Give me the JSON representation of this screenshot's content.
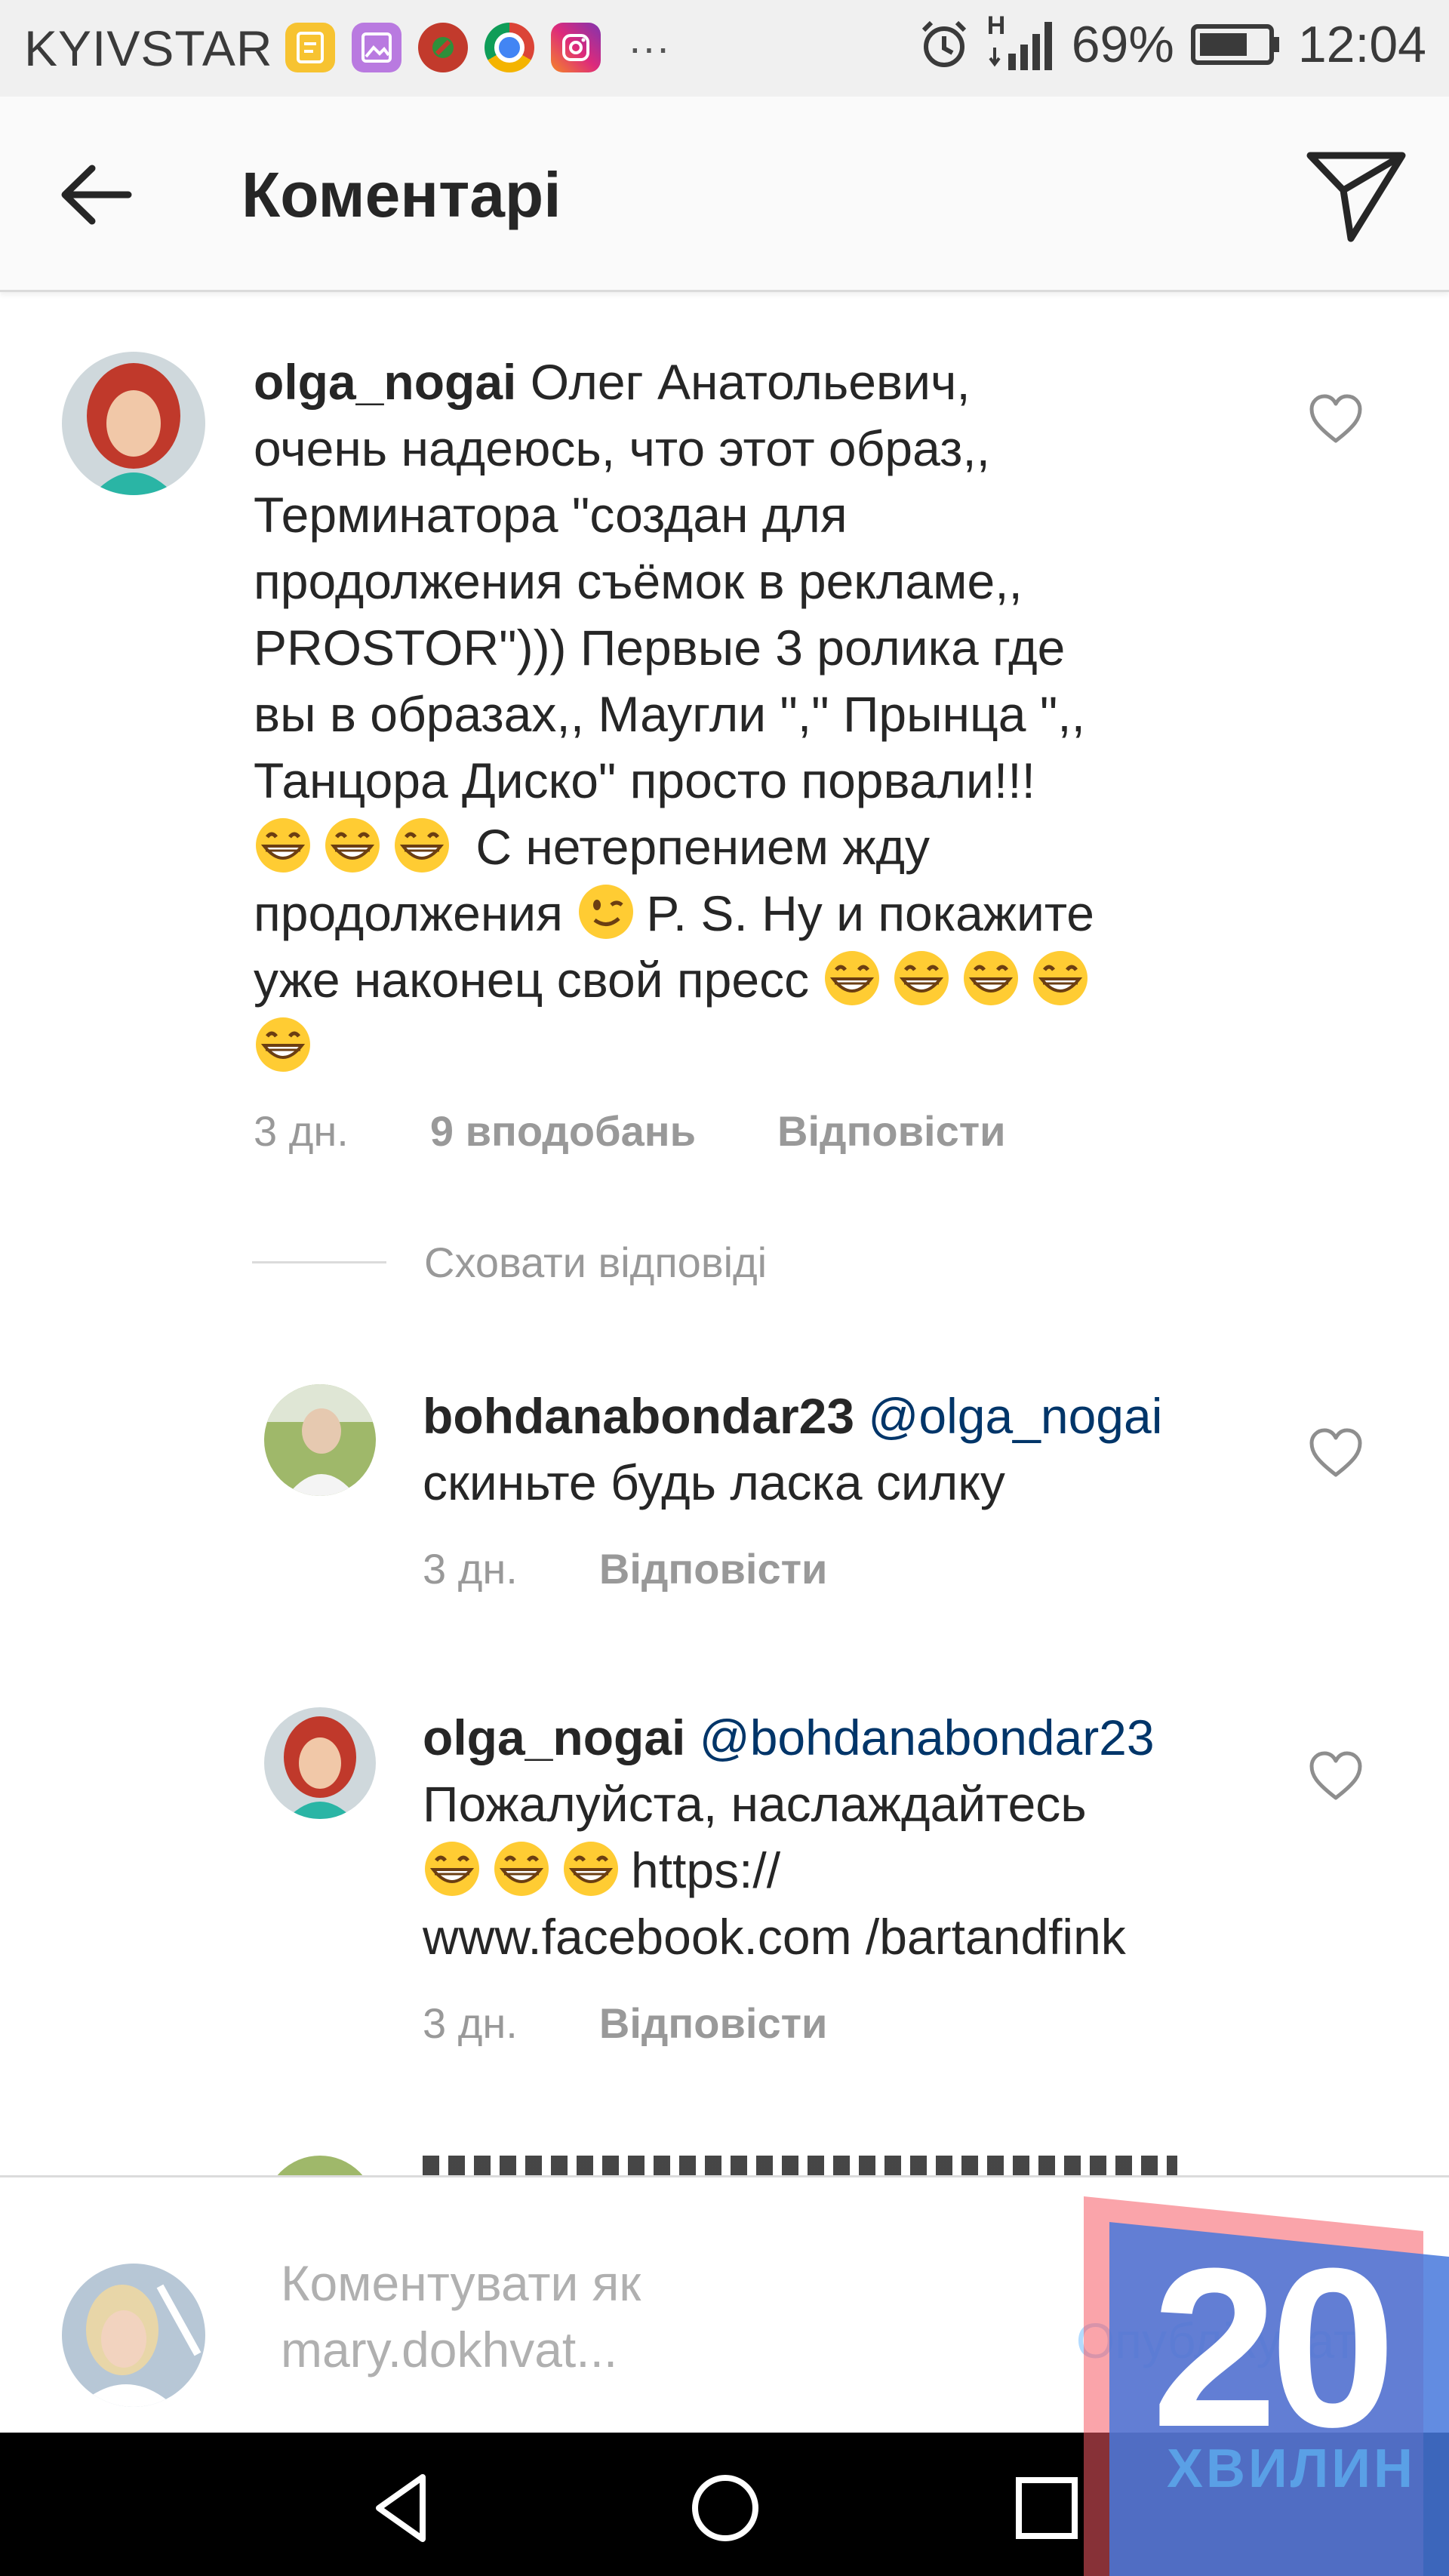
{
  "status_bar": {
    "carrier": "KYIVSTAR",
    "dots": "···",
    "battery_percent": "69%",
    "time": "12:04",
    "network_letter": "H",
    "icons": [
      "notes-icon",
      "gallery-icon",
      "app-icon",
      "chrome-icon",
      "instagram-icon"
    ]
  },
  "header": {
    "title": "Коментарі",
    "back_icon": "arrow-left-icon",
    "share_icon": "paper-plane-icon"
  },
  "comments": [
    {
      "username": "olga_nogai",
      "lines": [
        "Олег Анатольевич,",
        "очень надеюсь, что этот образ,,",
        "Терминатора \"создан для",
        "продолжения съёмок в рекламе,,",
        "PROSTOR\"))) Первые 3 ролика где",
        "вы в образах,, Маугли \",\" Прынца \",,",
        "Танцора Диско\" просто порвали!!!",
        " С нетерпением жду",
        "продолжения ",
        "P. S. Ну и покажите",
        "уже наконец свой пресс "
      ],
      "time": "3 дн.",
      "likes": "9 вподобань",
      "reply": "Відповісти"
    }
  ],
  "hide_replies": "Сховати відповіді",
  "replies": [
    {
      "username": "bohdanabondar23",
      "mention": "@olga_nogai",
      "lines": [
        "скиньте будь ласка силку"
      ],
      "time": "3 дн.",
      "reply": "Відповісти"
    },
    {
      "username": "olga_nogai",
      "mention": "@bohdanabondar23",
      "lines": [
        "Пожалуйста, наслаждайтесь",
        "https://",
        "www.facebook.com /bartandfink"
      ],
      "time": "3 дн.",
      "reply": "Відповісти"
    }
  ],
  "composer": {
    "placeholder_line1": "Коментувати як",
    "placeholder_line2": "mary.dokhvat...",
    "publish": "Опублікувати"
  },
  "watermark": {
    "number": "20",
    "text": "ХВИЛИН"
  },
  "colors": {
    "mention": "#003569",
    "meta_gray": "#999999",
    "publish_disabled": "#b3dbff",
    "header_bg": "#fafafa"
  }
}
